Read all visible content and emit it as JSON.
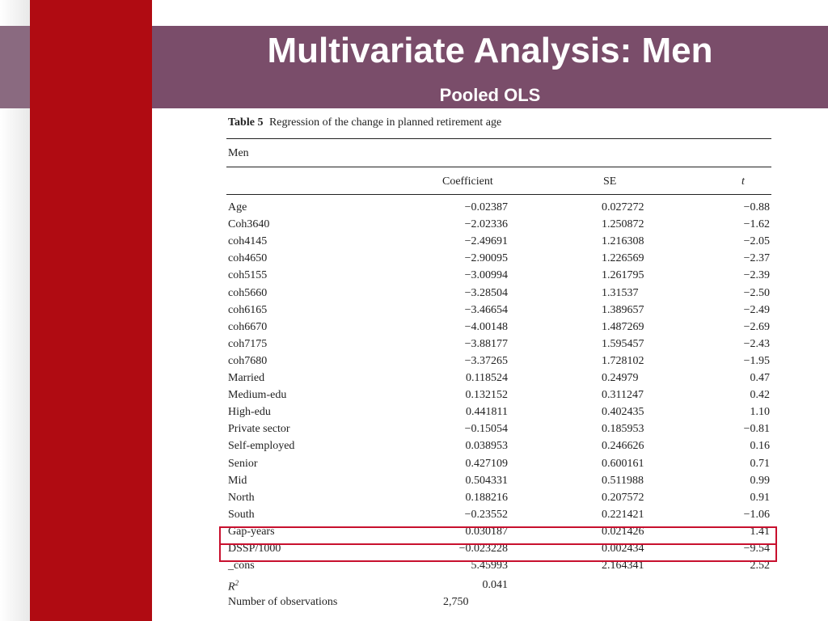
{
  "slide": {
    "title": "Multivariate Analysis: Men",
    "subtitle": "Pooled OLS"
  },
  "table": {
    "number_label": "Table 5",
    "caption": "Regression of the change in planned retirement age",
    "group": "Men",
    "columns": [
      "Coefficient",
      "SE",
      "t"
    ],
    "rows": [
      {
        "label": "Age",
        "coef": "−0.02387",
        "se": "0.027272",
        "t": "−0.88"
      },
      {
        "label": "Coh3640",
        "coef": "−2.02336",
        "se": "1.250872",
        "t": "−1.62"
      },
      {
        "label": "coh4145",
        "coef": "−2.49691",
        "se": "1.216308",
        "t": "−2.05"
      },
      {
        "label": "coh4650",
        "coef": "−2.90095",
        "se": "1.226569",
        "t": "−2.37"
      },
      {
        "label": "coh5155",
        "coef": "−3.00994",
        "se": "1.261795",
        "t": "−2.39"
      },
      {
        "label": "coh5660",
        "coef": "−3.28504",
        "se": "1.31537",
        "t": "−2.50"
      },
      {
        "label": "coh6165",
        "coef": "−3.46654",
        "se": "1.389657",
        "t": "−2.49"
      },
      {
        "label": "coh6670",
        "coef": "−4.00148",
        "se": "1.487269",
        "t": "−2.69"
      },
      {
        "label": "coh7175",
        "coef": "−3.88177",
        "se": "1.595457",
        "t": "−2.43"
      },
      {
        "label": "coh7680",
        "coef": "−3.37265",
        "se": "1.728102",
        "t": "−1.95"
      },
      {
        "label": "Married",
        "coef": "0.118524",
        "se": "0.24979",
        "t": "0.47"
      },
      {
        "label": "Medium-edu",
        "coef": "0.132152",
        "se": "0.311247",
        "t": "0.42"
      },
      {
        "label": "High-edu",
        "coef": "0.441811",
        "se": "0.402435",
        "t": "1.10"
      },
      {
        "label": "Private sector",
        "coef": "−0.15054",
        "se": "0.185953",
        "t": "−0.81"
      },
      {
        "label": "Self-employed",
        "coef": "0.038953",
        "se": "0.246626",
        "t": "0.16"
      },
      {
        "label": "Senior",
        "coef": "0.427109",
        "se": "0.600161",
        "t": "0.71"
      },
      {
        "label": "Mid",
        "coef": "0.504331",
        "se": "0.511988",
        "t": "0.99"
      },
      {
        "label": "North",
        "coef": "0.188216",
        "se": "0.207572",
        "t": "0.91"
      },
      {
        "label": "South",
        "coef": "−0.23552",
        "se": "0.221421",
        "t": "−1.06"
      },
      {
        "label": "Gap-years",
        "coef": "0.030187",
        "se": "0.021426",
        "t": "1.41"
      },
      {
        "label": "DSSP/1000",
        "coef": "−0.023228",
        "se": "0.002434",
        "t": "−9.54"
      },
      {
        "label": "_cons",
        "coef": "5.45993",
        "se": "2.164341",
        "t": "2.52"
      }
    ],
    "r2_label": "R",
    "r2_sup": "2",
    "r2_value": "0.041",
    "nobs_label": "Number of observations",
    "nobs_value": "2,750",
    "highlight_color": "#c8102e"
  }
}
